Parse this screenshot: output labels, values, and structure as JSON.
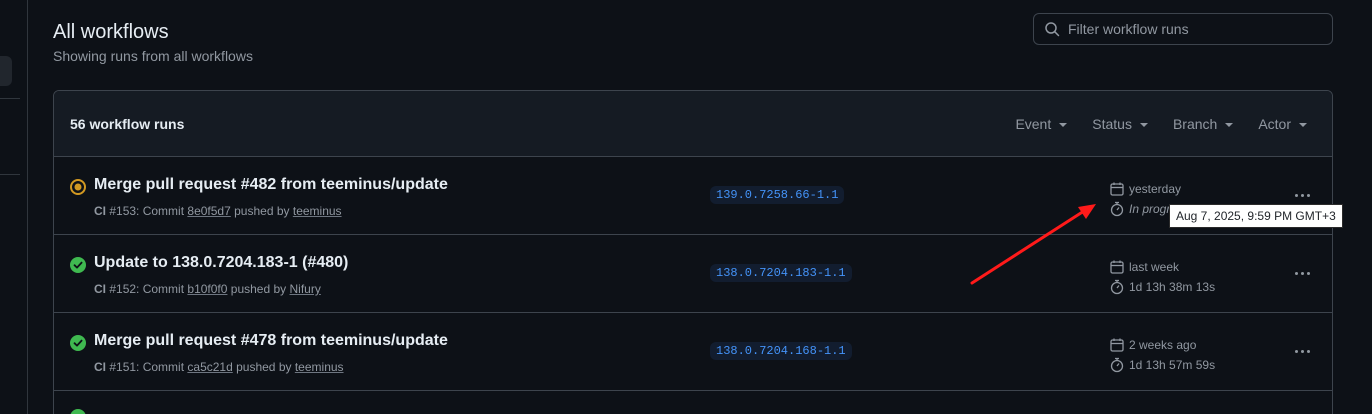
{
  "header": {
    "title": "All workflows",
    "subtitle": "Showing runs from all workflows"
  },
  "search": {
    "placeholder": "Filter workflow runs"
  },
  "list": {
    "count_label": "56 workflow runs",
    "filters": [
      "Event",
      "Status",
      "Branch",
      "Actor"
    ]
  },
  "runs": [
    {
      "status": "in-progress",
      "title": "Merge pull request #482 from teeminus/update",
      "workflow": "CI",
      "run_number": "#153",
      "commit_prefix": ": Commit",
      "commit": "8e0f5d7",
      "pushed_by": "pushed by",
      "actor": "teeminus",
      "branch": "139.0.7258.66-1.1",
      "when": "yesterday",
      "duration": "In progr"
    },
    {
      "status": "success",
      "title": "Update to 138.0.7204.183-1 (#480)",
      "workflow": "CI",
      "run_number": "#152",
      "commit_prefix": ": Commit",
      "commit": "b10f0f0",
      "pushed_by": "pushed by",
      "actor": "Nifury",
      "branch": "138.0.7204.183-1.1",
      "when": "last week",
      "duration": "1d 13h 38m 13s"
    },
    {
      "status": "success",
      "title": "Merge pull request #478 from teeminus/update",
      "workflow": "CI",
      "run_number": "#151",
      "commit_prefix": ": Commit",
      "commit": "ca5c21d",
      "pushed_by": "pushed by",
      "actor": "teeminus",
      "branch": "138.0.7204.168-1.1",
      "when": "2 weeks ago",
      "duration": "1d 13h 57m 59s"
    }
  ],
  "tooltip": {
    "text": "Aug 7, 2025, 9:59 PM GMT+3"
  },
  "colors": {
    "background": "#0d1117",
    "success": "#3fb950",
    "in_progress": "#d29922",
    "link": "#4493f8",
    "annotation_arrow": "#ff1a1a"
  }
}
